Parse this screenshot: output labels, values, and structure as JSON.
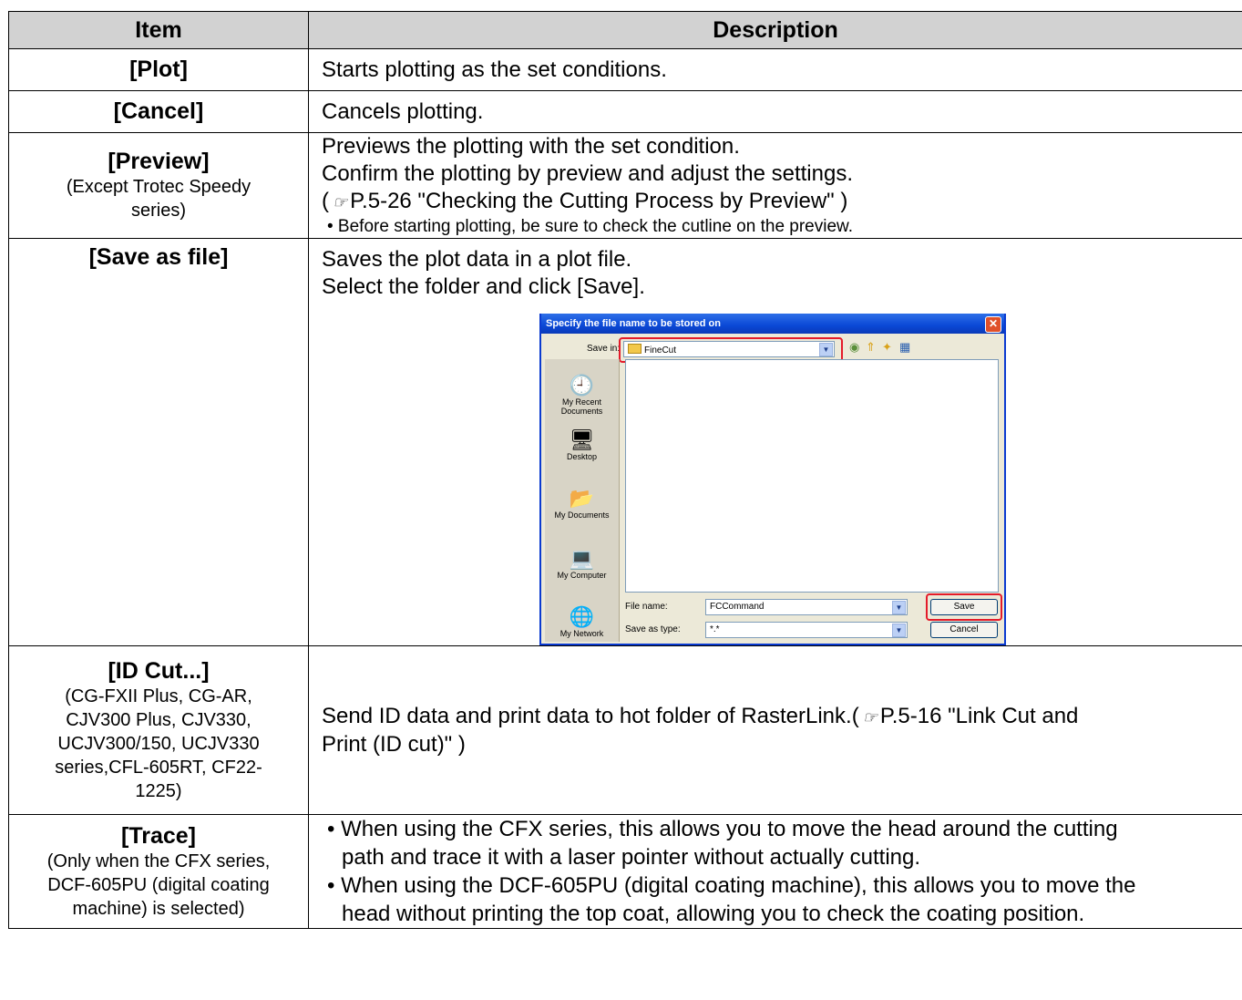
{
  "table": {
    "headers": {
      "item": "Item",
      "description": "Description"
    },
    "plot": {
      "name": "[Plot]",
      "desc": "Starts plotting as the set conditions."
    },
    "cancel": {
      "name": "[Cancel]",
      "desc": "Cancels plotting."
    },
    "preview": {
      "name": "[Preview]",
      "sub1": "(Except Trotec Speedy",
      "sub2": "series)",
      "line1": "Previews the plotting with the set condition.",
      "line2": "Confirm the plotting by preview and adjust the settings.",
      "ref_open": "(",
      "ref": "P.5-26 \"Checking the Cutting Process by Preview\" )",
      "note": "• Before starting plotting, be sure to check the cutline on the preview."
    },
    "save": {
      "name": "[Save as file]",
      "line1": "Saves the plot data in a plot file.",
      "line2": "Select the folder and click [Save]."
    },
    "idcut": {
      "name": "[ID Cut...]",
      "sub1": "(CG-FXII Plus, CG-AR,",
      "sub2": "CJV300 Plus, CJV330,",
      "sub3": "UCJV300/150, UCJV330",
      "sub4": "series,CFL-605RT, CF22-",
      "sub5": "1225)",
      "desc_a": "Send ID data and print data to hot folder of RasterLink.(",
      "desc_b": "P.5-16 \"Link Cut and",
      "desc_c": "Print (ID cut)\" )"
    },
    "trace": {
      "name": "[Trace]",
      "sub1": "(Only when the CFX series,",
      "sub2": "DCF-605PU (digital coating",
      "sub3": "machine) is selected)",
      "bullet1a": "• When using the CFX series, this allows you to move the head around the cutting",
      "bullet1b": "path and trace it with a laser pointer without actually cutting.",
      "bullet2a": "• When using the DCF-605PU (digital coating machine), this allows you to move the",
      "bullet2b": "head without printing the top coat, allowing you to check the coating position."
    }
  },
  "dialog": {
    "title": "Specify the file name to be stored on",
    "save_in_label": "Save in:",
    "save_in_value": "FineCut",
    "places": [
      "My Recent Documents",
      "Desktop",
      "My Documents",
      "My Computer",
      "My Network"
    ],
    "file_name_label": "File name:",
    "file_name_value": "FCCommand",
    "save_type_label": "Save as type:",
    "save_type_value": "*.*",
    "save_button": "Save",
    "cancel_button": "Cancel"
  },
  "colors": {
    "header_bg": "#d2d2d2",
    "highlight": "#e41b2a",
    "title_bar": "#0a48d6"
  },
  "icons": {
    "reference": "reference-hand-icon"
  }
}
